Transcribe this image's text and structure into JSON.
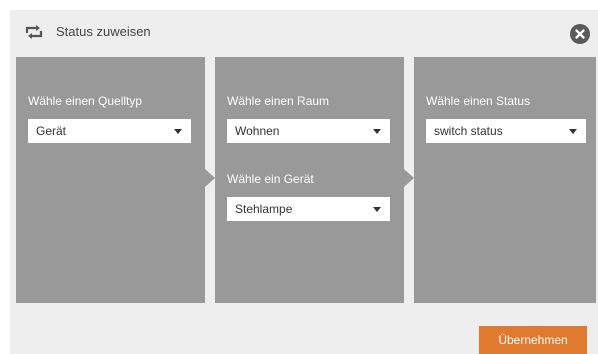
{
  "dialog": {
    "title": "Status zuweisen",
    "icons": {
      "title": "repeat-arrows-icon",
      "close": "close-circle-icon"
    }
  },
  "source_panel": {
    "label": "Wähle einen Quelltyp",
    "select_value": "Gerät"
  },
  "room_panel": {
    "room_label": "Wähle einen Raum",
    "room_select_value": "Wohnen",
    "device_label": "Wähle ein Gerät",
    "device_select_value": "Stehlampe"
  },
  "status_panel": {
    "label": "Wähle einen Status",
    "select_value": "switch status"
  },
  "footer": {
    "apply_label": "Übernehmen"
  },
  "colors": {
    "panel": "#999999",
    "dialog_bg": "#eeeeee",
    "accent": "#e07a2e",
    "close": "#5a5a5a"
  }
}
